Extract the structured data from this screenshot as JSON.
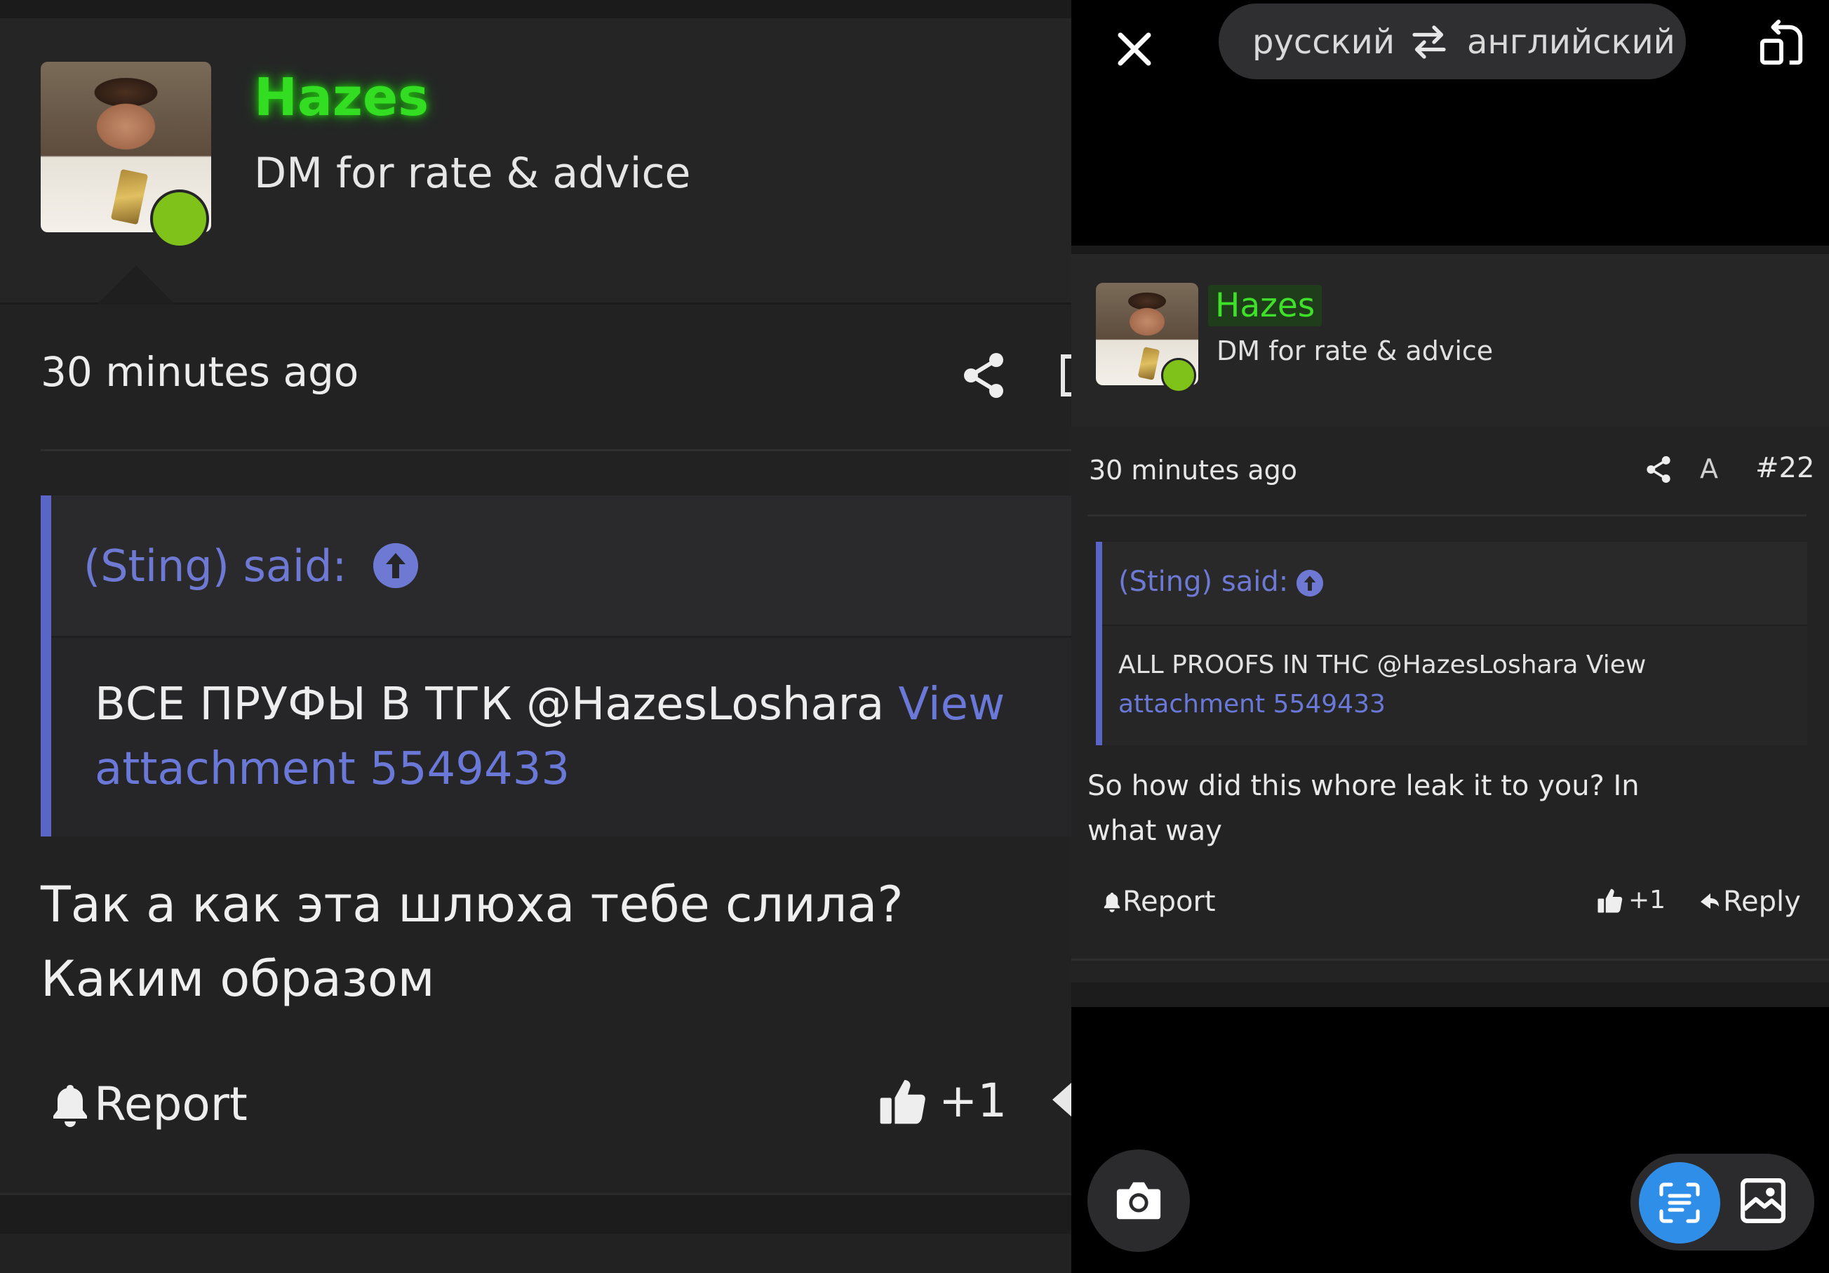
{
  "left_post": {
    "username": "Hazes",
    "user_title": "DM for rate & advice",
    "time": "30 minutes ago",
    "quote": {
      "author": "(Sting) said:",
      "text": "ВСЕ ПРУФЫ В ТГК @HazesLoshara ",
      "link": "View attachment 5549433"
    },
    "message": "Так а как эта шлюха тебе слила? Каким образом",
    "report_label": "Report",
    "like_count": "+1"
  },
  "translator": {
    "source_language": "русский",
    "target_language": "английский"
  },
  "right_post": {
    "username": "Hazes",
    "user_title": "DM for rate & advice",
    "time": "30 minutes ago",
    "font_button": "A",
    "post_number": "#22",
    "quote": {
      "author": "(Sting) said:",
      "text": "ALL PROOFS IN THC @HazesLoshara View",
      "link": "attachment 5549433"
    },
    "message": "So how did this whore leak it to you? In what way",
    "report_label": "Report",
    "like_count": "+1",
    "reply_label": "Reply"
  },
  "colors": {
    "username_green": "#33dd22",
    "online_dot": "#7ec21a",
    "quote_accent": "#5a66c7",
    "link_blue": "#6a78d8",
    "active_mode_blue": "#2f8fe8"
  },
  "icons": [
    "share-icon",
    "bookmark-icon",
    "arrow-up-circle-icon",
    "bell-icon",
    "thumbs-up-icon",
    "reply-arrow-icon",
    "close-icon",
    "swap-icon",
    "rotate-icon",
    "camera-icon",
    "text-scan-icon",
    "image-icon"
  ]
}
